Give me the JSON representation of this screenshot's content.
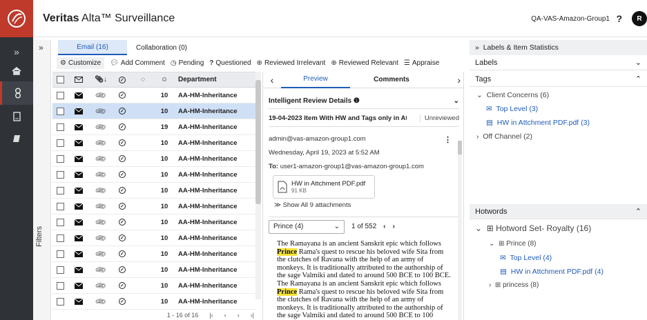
{
  "app": {
    "title_bold": "Veritas",
    "title_rest": " Alta™ Surveillance",
    "group": "QA-VAS-Amazon-Group1",
    "help": "?",
    "avatar": "R"
  },
  "filters": {
    "label": "Filters",
    "toggle": "»"
  },
  "tabs": [
    {
      "label": "Email (16)",
      "active": true
    },
    {
      "label": "Collaboration (0)",
      "active": false
    }
  ],
  "toolbar": {
    "customize": "Customize",
    "add_comment": "Add Comment",
    "pending": "Pending",
    "questioned": "Questioned",
    "reviewed_irrelevant": "Reviewed Irrelevant",
    "reviewed_relevant": "Reviewed Relevant",
    "appraise": "Appraise"
  },
  "grid": {
    "department_header": "Department",
    "rows": [
      {
        "count": "10",
        "department": "AA-HM-Inheritance",
        "selected": false
      },
      {
        "count": "10",
        "department": "AA-HM-Inheritance",
        "selected": true
      },
      {
        "count": "19",
        "department": "AA-HM-Inheritance",
        "selected": false
      },
      {
        "count": "10",
        "department": "AA-HM-Inheritance",
        "selected": false
      },
      {
        "count": "10",
        "department": "AA-HM-Inheritance",
        "selected": false
      },
      {
        "count": "10",
        "department": "AA-HM-Inheritance",
        "selected": false
      },
      {
        "count": "10",
        "department": "AA-HM-Inheritance",
        "selected": false
      },
      {
        "count": "10",
        "department": "AA-HM-Inheritance",
        "selected": false
      },
      {
        "count": "10",
        "department": "AA-HM-Inheritance",
        "selected": false
      },
      {
        "count": "10",
        "department": "AA-HM-Inheritance",
        "selected": false
      },
      {
        "count": "10",
        "department": "AA-HM-Inheritance",
        "selected": false
      },
      {
        "count": "10",
        "department": "AA-HM-Inheritance",
        "selected": false
      },
      {
        "count": "10",
        "department": "AA-HM-Inheritance",
        "selected": false
      },
      {
        "count": "10",
        "department": "AA-HM-Inheritance",
        "selected": false
      }
    ],
    "pager": "1 - 16 of 16"
  },
  "preview": {
    "tab_preview": "Preview",
    "tab_comments": "Comments",
    "ir_label": "Intelligent Review Details",
    "item_title": "19-04-2023 Item With HW and Tags only in Att...",
    "item_status": "Unreviewed",
    "from": "admin@vas-amazon-group1.com",
    "date": "Wednesday, April 19, 2023 at 5:52 AM",
    "to_label": "To:",
    "to": "user1-amazon-group1@vas-amazon-group1.com",
    "attachment_name": "HW in Attchment PDF.pdf",
    "attachment_size": "91 KB",
    "show_all": "Show All 9 attachments",
    "hit_select": "Prince (4)",
    "hit_counter": "1 of 552",
    "body_1": "The Ramayana is an ancient Sanskrit epic which follows ",
    "hit_word": "Prince",
    "body_2": " Rama's quest to rescue his beloved wife Sita from the clutches of Ravana with the help of an army of monkeys. It is traditionally attributed to the authorship of the sage Valmiki and dated to around 500 BCE to 100 BCE. The Ramayana is an ancient Sanskrit epic which follows ",
    "body_3": " Rama's quest to rescue his beloved wife Sita from the clutches of Ravana with the help of an army of monkeys. It is traditionally attributed to the authorship of the sage Valmiki and dated to around 500 BCE to 100"
  },
  "right": {
    "panel_title": "Labels & Item Statistics",
    "labels": "Labels",
    "tags": "Tags",
    "client_concerns": "Client Concerns (6)",
    "top_level": "Top Level (3)",
    "hw_attachment": "HW in Attchment PDF.pdf (3)",
    "off_channel": "Off Channel (2)",
    "hotwords": "Hotwords",
    "hotword_set": "Hotword Set- Royalty (16)",
    "prince": "Prince (8)",
    "hw_top_level": "Top Level (4)",
    "hw_pdf": "HW in Attchment PDF.pdf (4)",
    "princess": "princess (8)"
  },
  "colors": {
    "brand": "#bf3a2b",
    "nav": "#2f3237",
    "link": "#1e5bb8",
    "highlight": "#f5e23a",
    "selected_row": "#cfe0f6"
  }
}
